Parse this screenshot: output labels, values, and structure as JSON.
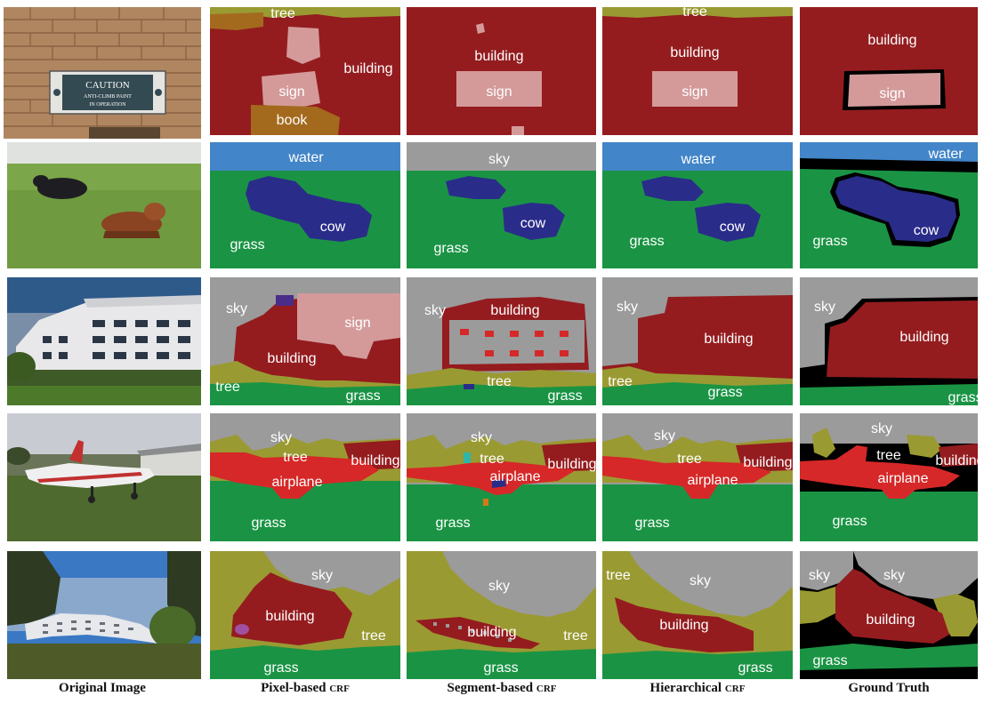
{
  "figure": {
    "columns": [
      {
        "main": "Original Image",
        "suffix": ""
      },
      {
        "main": "Pixel-based ",
        "suffix": "CRF"
      },
      {
        "main": "Segment-based ",
        "suffix": "CRF"
      },
      {
        "main": "Hierarchical ",
        "suffix": "CRF"
      },
      {
        "main": "Ground Truth",
        "suffix": ""
      }
    ],
    "class_colors": {
      "building": "#941c1f",
      "sign": "#d49a9a",
      "tree": "#9a9a32",
      "book": "#a36a1e",
      "water": "#4285c8",
      "grass": "#1a9444",
      "sky": "#9b9b9b",
      "cow": "#2a2c8a",
      "airplane": "#d62828",
      "void": "#000000"
    },
    "photos": [
      {
        "sign_line1": "CAUTION",
        "sign_line2": "ANTI-CLIMB PAINT",
        "sign_line3": "IN OPERATION"
      }
    ],
    "rows": [
      {
        "labels": [
          [
            "tree",
            "building",
            "sign",
            "book"
          ],
          [
            "building",
            "sign"
          ],
          [
            "tree",
            "building",
            "sign"
          ],
          [
            "building",
            "sign"
          ]
        ]
      },
      {
        "labels": [
          [
            "water",
            "grass",
            "cow"
          ],
          [
            "sky",
            "cow",
            "grass"
          ],
          [
            "water",
            "cow",
            "grass"
          ],
          [
            "water",
            "grass",
            "cow"
          ]
        ]
      },
      {
        "labels": [
          [
            "sky",
            "sign",
            "building",
            "tree",
            "grass"
          ],
          [
            "sky",
            "building",
            "tree",
            "grass"
          ],
          [
            "sky",
            "building",
            "tree",
            "grass"
          ],
          [
            "sky",
            "building",
            "grass"
          ]
        ]
      },
      {
        "labels": [
          [
            "sky",
            "tree",
            "building",
            "airplane",
            "grass"
          ],
          [
            "sky",
            "tree",
            "building",
            "airplane",
            "grass"
          ],
          [
            "sky",
            "tree",
            "building",
            "airplane",
            "grass"
          ],
          [
            "sky",
            "tree",
            "building",
            "airplane",
            "grass"
          ]
        ]
      },
      {
        "labels": [
          [
            "sky",
            "building",
            "tree",
            "grass"
          ],
          [
            "sky",
            "building",
            "tree",
            "grass"
          ],
          [
            "tree",
            "sky",
            "building",
            "grass"
          ],
          [
            "sky",
            "sky",
            "building",
            "grass"
          ]
        ]
      }
    ]
  }
}
